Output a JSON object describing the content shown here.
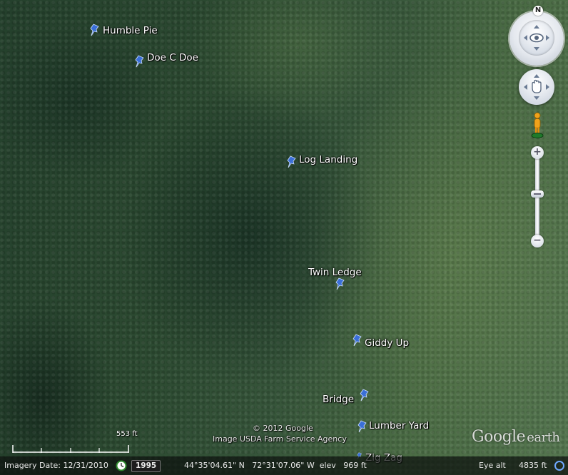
{
  "placemarks": [
    {
      "label": "Humble Pie"
    },
    {
      "label": "Doe C Doe"
    },
    {
      "label": "Log Landing"
    },
    {
      "label": "Twin Ledge"
    },
    {
      "label": "Giddy Up"
    },
    {
      "label": "Bridge"
    },
    {
      "label": "Lumber Yard"
    },
    {
      "label": "Zig Zag"
    }
  ],
  "navigation": {
    "north_label": "N",
    "zoom_in_label": "+",
    "zoom_out_label": "−",
    "zoom_level_fraction": 0.48
  },
  "scale": {
    "label": "553 ft"
  },
  "attribution": {
    "copyright": "© 2012 Google",
    "imagery": "Image USDA Farm Service Agency"
  },
  "logo": {
    "name": "Google",
    "suffix": "earth"
  },
  "status_bar": {
    "imagery_date": "Imagery Date: 12/31/2010",
    "history_year": "1995",
    "coordinates": "44°35'04.61\" N   72°31'07.06\" W  elev   969 ft",
    "eye_alt_label": "Eye alt",
    "eye_alt_value": "4835 ft"
  },
  "colors": {
    "pin": "#3a6fd8",
    "label": "#ffffff"
  },
  "icons": {
    "placemark": "pushpin-icon",
    "look": "look-around-icon",
    "move": "move-hand-icon",
    "street_view": "pegman-icon",
    "history": "history-clock-icon",
    "streaming": "streaming-icon"
  }
}
